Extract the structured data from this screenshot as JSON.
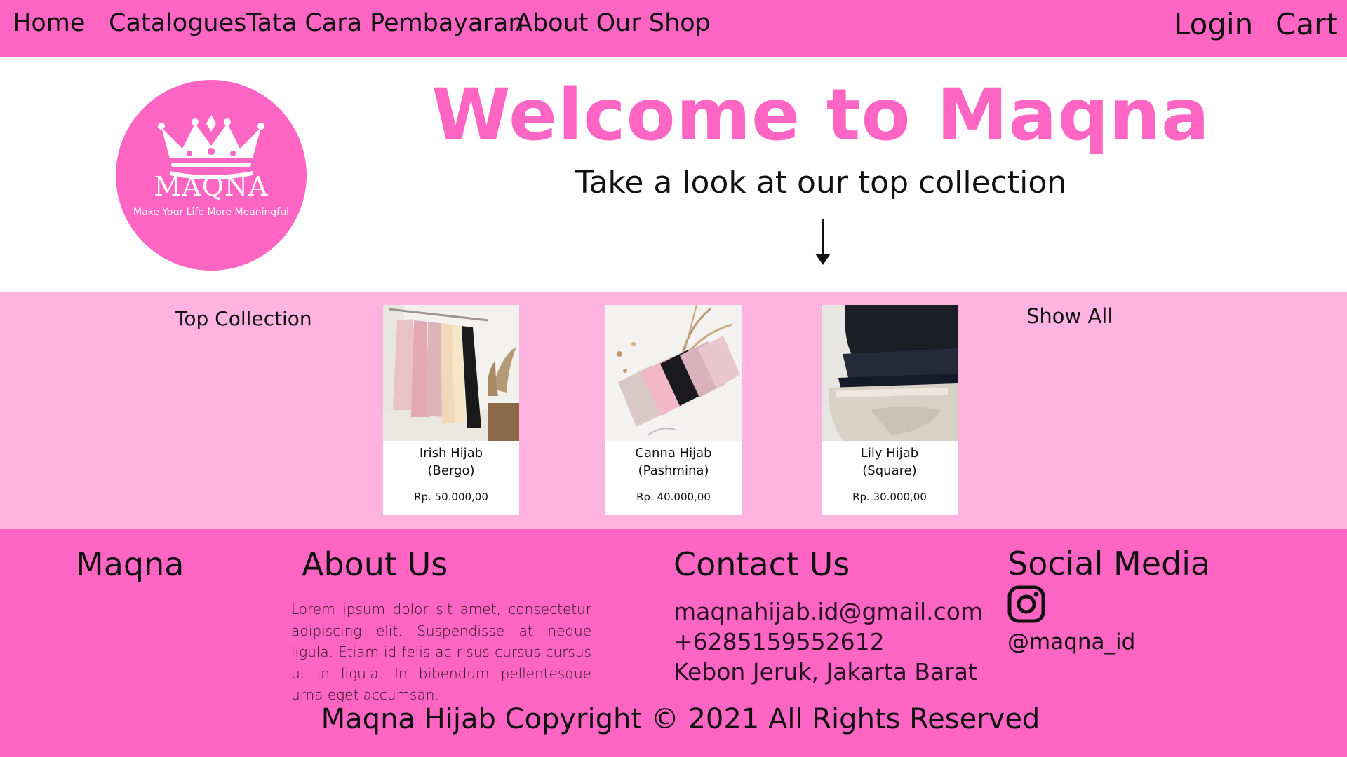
{
  "nav": {
    "home": "Home",
    "catalogues": "Catalogues",
    "payment": "Tata Cara Pembayaran",
    "about": "About Our Shop",
    "login": "Login",
    "cart": "Cart"
  },
  "logo": {
    "word": "MAQNA",
    "tagline": "Make Your Life More Meaningful"
  },
  "hero": {
    "title": "Welcome to Maqna",
    "subtitle": "Take a look  at our top collection",
    "arrow_icon": "arrow-down-icon"
  },
  "collection": {
    "title": "Top Collection",
    "show_all": "Show All",
    "products": [
      {
        "name_line1": "Irish Hijab",
        "name_line2": "(Bergo)",
        "price": "Rp. 50.000,00"
      },
      {
        "name_line1": "Canna Hijab",
        "name_line2": "(Pashmina)",
        "price": "Rp. 40.000,00"
      },
      {
        "name_line1": "Lily Hijab",
        "name_line2": "(Square)",
        "price": "Rp. 30.000,00"
      }
    ]
  },
  "footer": {
    "brand": "Maqna",
    "about_title": "About Us",
    "about_text": "Lorem ipsum dolor sit amet, consectetur adipiscing elit. Suspendisse at neque ligula. Etiam id felis ac risus cursus cursus ut in ligula. In bibendum pellentesque urna eget accumsan.",
    "contact_title": "Contact Us",
    "email": "maqnahijab.id@gmail.com",
    "phone": "+6285159552612",
    "address": "Kebon Jeruk, Jakarta Barat",
    "social_title": "Social Media",
    "social_icon": "instagram-icon",
    "instagram_handle": "@maqna_id",
    "copyright": "Maqna Hijab Copyright © 2021 All Rights Reserved"
  },
  "colors": {
    "primary_pink": "#ff66c4",
    "light_pink": "#ffb3e1",
    "white": "#ffffff"
  }
}
